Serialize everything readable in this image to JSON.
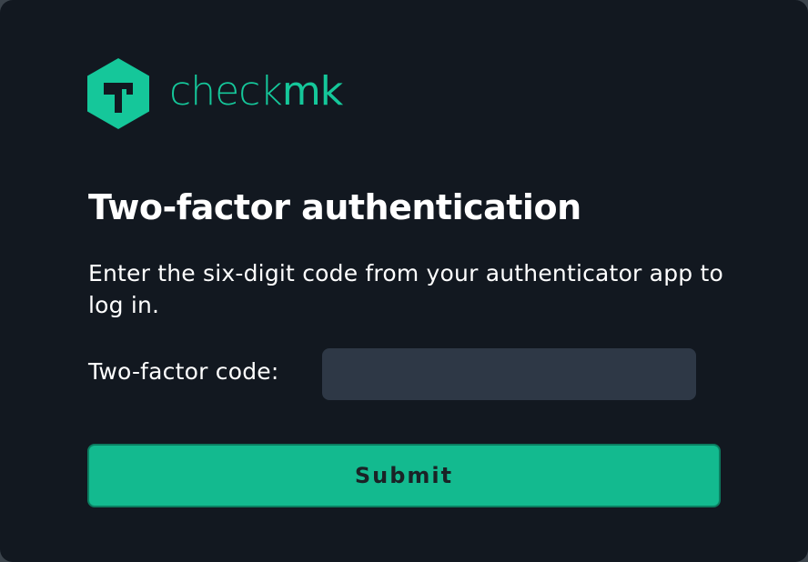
{
  "brand": {
    "logo_icon": "checkmk-hexagon-logo",
    "name_light": "check",
    "name_bold": "mk",
    "color": "#15c79a"
  },
  "page": {
    "title": "Two-factor authentication",
    "description": "Enter the six-digit code from your authenticator app to log in."
  },
  "form": {
    "code_label": "Two-factor code:",
    "code_value": "",
    "code_placeholder": "",
    "submit_label": "Submit"
  },
  "colors": {
    "background": "#121820",
    "input_background": "#2e3846",
    "button_background": "#13ba8f",
    "button_border": "#0c7d60",
    "text": "#ffffff"
  }
}
